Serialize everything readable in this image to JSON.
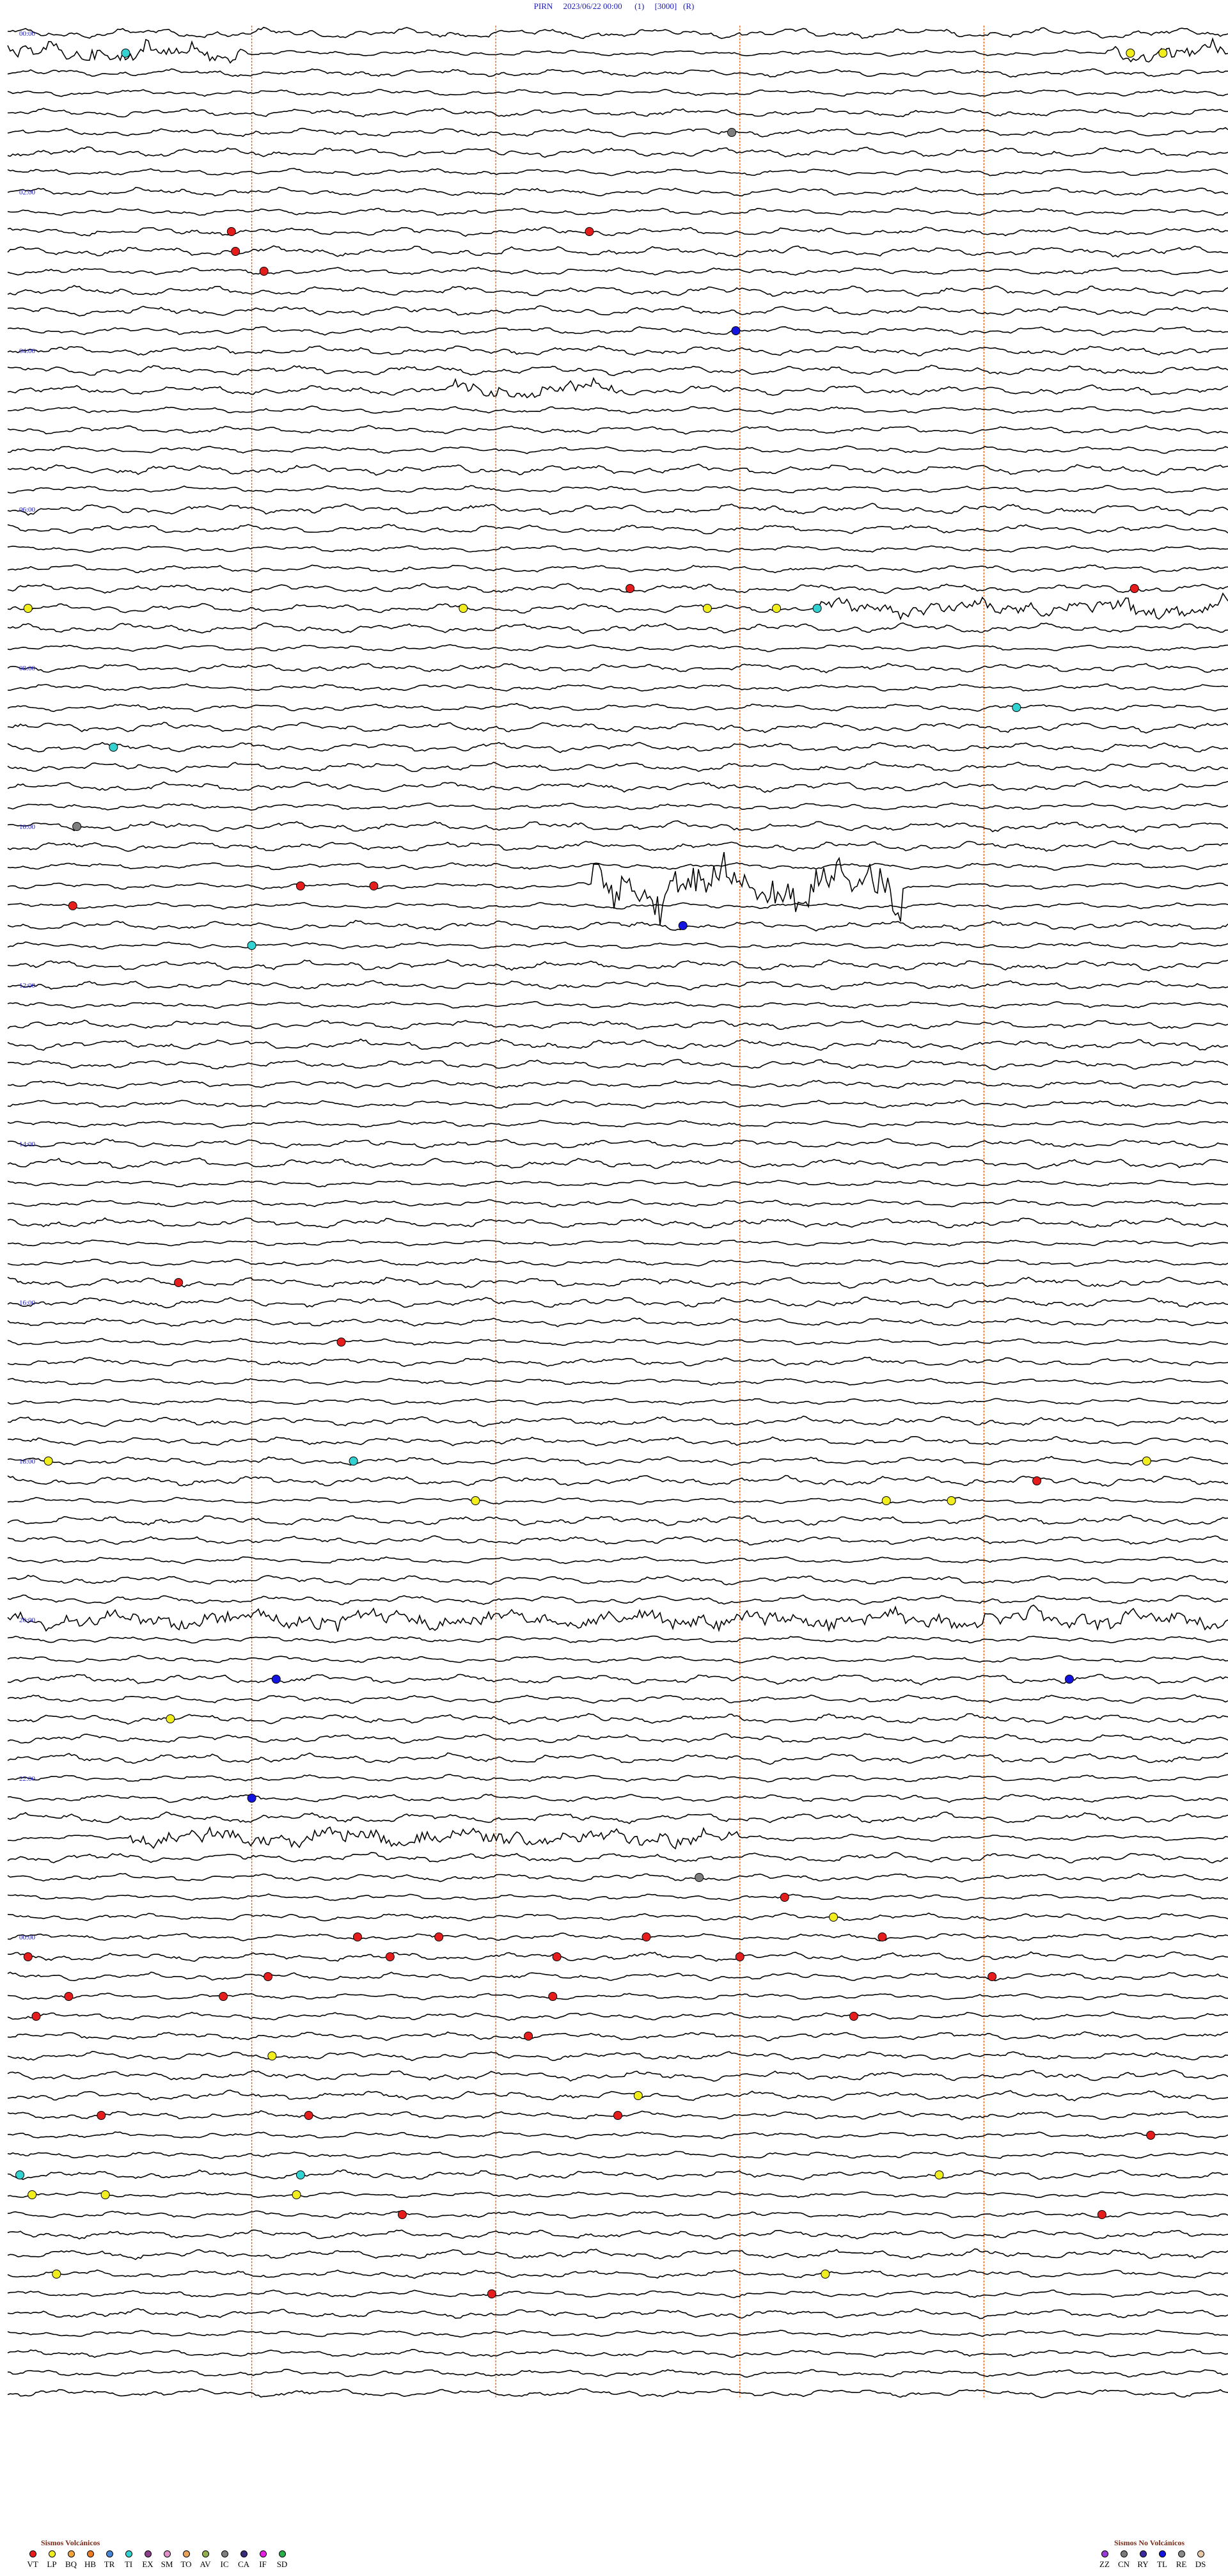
{
  "header": {
    "station": "PIRN",
    "datetime": "2023/06/22 00:00",
    "channel": "(1)",
    "gain": "[3000]",
    "flag": "(R)"
  },
  "chart_data": {
    "type": "line",
    "title": "PIRN    2023/06/22 00:00     (1)    [3000]   (R)",
    "xlabel": "",
    "ylabel": "",
    "minutes_per_row": 15,
    "rows": 96,
    "hour_markers": [
      "00:00",
      "02:00",
      "04:00",
      "06:00",
      "08:00",
      "10:00",
      "12:00",
      "14:00",
      "16:00",
      "18:00",
      "20:00",
      "22:00",
      "00:00"
    ],
    "minute_gridlines": [
      3,
      6,
      9,
      12
    ],
    "grid": true,
    "colors": {
      "trace": "#000000",
      "gridline": "#e8651f",
      "hour_label": "#1a1ab8"
    },
    "highlighted_segments": [
      {
        "row": 1,
        "start_min": 0.0,
        "end_min": 3.0,
        "note": "noise"
      },
      {
        "row": 1,
        "start_min": 13.5,
        "end_min": 15.0,
        "note": "noise"
      },
      {
        "row": 18,
        "start_min": 5.5,
        "end_min": 7.5,
        "note": "small burst"
      },
      {
        "row": 29,
        "start_min": 10.0,
        "end_min": 15.0,
        "note": "noise"
      },
      {
        "row": 43,
        "start_min": 7.2,
        "end_min": 11.0,
        "note": "large event"
      },
      {
        "row": 80,
        "start_min": 0.0,
        "end_min": 15.0,
        "note": "noise"
      },
      {
        "row": 91,
        "start_min": 1.5,
        "end_min": 9.0,
        "note": "noise"
      }
    ],
    "event_markers": [
      {
        "row": 1,
        "min": 1.45,
        "cls": "TI"
      },
      {
        "row": 1,
        "min": 13.8,
        "cls": "LP"
      },
      {
        "row": 1,
        "min": 14.2,
        "cls": "LP"
      },
      {
        "row": 5,
        "min": 8.9,
        "cls": "IC"
      },
      {
        "row": 10,
        "min": 2.75,
        "cls": "VT"
      },
      {
        "row": 10,
        "min": 7.15,
        "cls": "VT"
      },
      {
        "row": 11,
        "min": 2.8,
        "cls": "VT"
      },
      {
        "row": 12,
        "min": 3.15,
        "cls": "VT"
      },
      {
        "row": 15,
        "min": 8.95,
        "cls": "TL"
      },
      {
        "row": 28,
        "min": 7.65,
        "cls": "VT"
      },
      {
        "row": 28,
        "min": 13.85,
        "cls": "VT"
      },
      {
        "row": 29,
        "min": 0.25,
        "cls": "LP"
      },
      {
        "row": 29,
        "min": 5.6,
        "cls": "LP"
      },
      {
        "row": 29,
        "min": 8.6,
        "cls": "LP"
      },
      {
        "row": 29,
        "min": 9.45,
        "cls": "LP"
      },
      {
        "row": 29,
        "min": 9.95,
        "cls": "TI"
      },
      {
        "row": 34,
        "min": 12.4,
        "cls": "TI"
      },
      {
        "row": 36,
        "min": 1.3,
        "cls": "TI"
      },
      {
        "row": 40,
        "min": 0.85,
        "cls": "IC"
      },
      {
        "row": 43,
        "min": 3.6,
        "cls": "VT"
      },
      {
        "row": 43,
        "min": 4.5,
        "cls": "VT"
      },
      {
        "row": 44,
        "min": 0.8,
        "cls": "VT"
      },
      {
        "row": 45,
        "min": 8.3,
        "cls": "TL"
      },
      {
        "row": 46,
        "min": 3.0,
        "cls": "TI"
      },
      {
        "row": 63,
        "min": 2.1,
        "cls": "VT"
      },
      {
        "row": 66,
        "min": 4.1,
        "cls": "VT"
      },
      {
        "row": 72,
        "min": 0.5,
        "cls": "LP"
      },
      {
        "row": 72,
        "min": 4.25,
        "cls": "TI"
      },
      {
        "row": 72,
        "min": 14.0,
        "cls": "LP"
      },
      {
        "row": 73,
        "min": 12.65,
        "cls": "VT"
      },
      {
        "row": 74,
        "min": 5.75,
        "cls": "LP"
      },
      {
        "row": 74,
        "min": 10.8,
        "cls": "LP"
      },
      {
        "row": 74,
        "min": 11.6,
        "cls": "LP"
      },
      {
        "row": 83,
        "min": 3.3,
        "cls": "TL"
      },
      {
        "row": 83,
        "min": 13.05,
        "cls": "TL"
      },
      {
        "row": 85,
        "min": 2.0,
        "cls": "LP"
      },
      {
        "row": 89,
        "min": 3.0,
        "cls": "TL"
      },
      {
        "row": 93,
        "min": 8.5,
        "cls": "IC"
      },
      {
        "row": 94,
        "min": 9.55,
        "cls": "VT"
      },
      {
        "row": 95,
        "min": 10.15,
        "cls": "LP"
      },
      {
        "row": 96,
        "min": 4.3,
        "cls": "VT"
      },
      {
        "row": 96,
        "min": 5.3,
        "cls": "VT"
      },
      {
        "row": 96,
        "min": 7.85,
        "cls": "VT"
      },
      {
        "row": 96,
        "min": 10.75,
        "cls": "VT"
      },
      {
        "row": 97,
        "min": 0.25,
        "cls": "VT"
      },
      {
        "row": 97,
        "min": 4.7,
        "cls": "VT"
      },
      {
        "row": 97,
        "min": 6.75,
        "cls": "VT"
      },
      {
        "row": 97,
        "min": 9.0,
        "cls": "VT"
      },
      {
        "row": 98,
        "min": 3.2,
        "cls": "VT"
      },
      {
        "row": 98,
        "min": 12.1,
        "cls": "VT"
      },
      {
        "row": 99,
        "min": 0.75,
        "cls": "VT"
      },
      {
        "row": 99,
        "min": 2.65,
        "cls": "VT"
      },
      {
        "row": 99,
        "min": 6.7,
        "cls": "VT"
      },
      {
        "row": 100,
        "min": 0.35,
        "cls": "VT"
      },
      {
        "row": 100,
        "min": 10.4,
        "cls": "VT"
      },
      {
        "row": 101,
        "min": 6.4,
        "cls": "VT"
      },
      {
        "row": 102,
        "min": 3.25,
        "cls": "LP"
      },
      {
        "row": 104,
        "min": 7.75,
        "cls": "LP"
      },
      {
        "row": 105,
        "min": 1.15,
        "cls": "VT"
      },
      {
        "row": 105,
        "min": 3.7,
        "cls": "VT"
      },
      {
        "row": 105,
        "min": 7.5,
        "cls": "VT"
      },
      {
        "row": 106,
        "min": 14.05,
        "cls": "VT"
      },
      {
        "row": 108,
        "min": 0.15,
        "cls": "TI"
      },
      {
        "row": 108,
        "min": 3.6,
        "cls": "TI"
      },
      {
        "row": 108,
        "min": 11.45,
        "cls": "LP"
      },
      {
        "row": 109,
        "min": 0.3,
        "cls": "LP"
      },
      {
        "row": 109,
        "min": 1.2,
        "cls": "LP"
      },
      {
        "row": 109,
        "min": 3.55,
        "cls": "LP"
      },
      {
        "row": 110,
        "min": 4.85,
        "cls": "VT"
      },
      {
        "row": 110,
        "min": 13.45,
        "cls": "VT"
      },
      {
        "row": 113,
        "min": 0.6,
        "cls": "LP"
      },
      {
        "row": 113,
        "min": 10.05,
        "cls": "LP"
      },
      {
        "row": 114,
        "min": 5.95,
        "cls": "VT"
      }
    ],
    "legend_volcanic": {
      "title": "Sismos Volcánicos",
      "items": [
        {
          "code": "VT",
          "color": "#e51d1d"
        },
        {
          "code": "LP",
          "color": "#f2ee1e"
        },
        {
          "code": "BQ",
          "color": "#f6a53a"
        },
        {
          "code": "HB",
          "color": "#f07c22"
        },
        {
          "code": "TR",
          "color": "#4a86d6"
        },
        {
          "code": "TI",
          "color": "#32d2d2"
        },
        {
          "code": "EX",
          "color": "#8a3d8a"
        },
        {
          "code": "SM",
          "color": "#e090c8"
        },
        {
          "code": "TO",
          "color": "#e8a25a"
        },
        {
          "code": "AV",
          "color": "#8fb04a"
        },
        {
          "code": "IC",
          "color": "#7e7e7e"
        },
        {
          "code": "CA",
          "color": "#3a2a7a"
        },
        {
          "code": "IF",
          "color": "#e61ee6"
        },
        {
          "code": "SD",
          "color": "#2ab04a"
        }
      ]
    },
    "legend_nonvolcanic": {
      "title": "Sismos No Volcánicos",
      "items": [
        {
          "code": "ZZ",
          "color": "#9a3ad6"
        },
        {
          "code": "CN",
          "color": "#7a7a7a"
        },
        {
          "code": "RY",
          "color": "#3a2aa0"
        },
        {
          "code": "TL",
          "color": "#1414e0"
        },
        {
          "code": "RE",
          "color": "#8a8a8a"
        },
        {
          "code": "DS",
          "color": "#e6c8a8"
        }
      ]
    }
  }
}
